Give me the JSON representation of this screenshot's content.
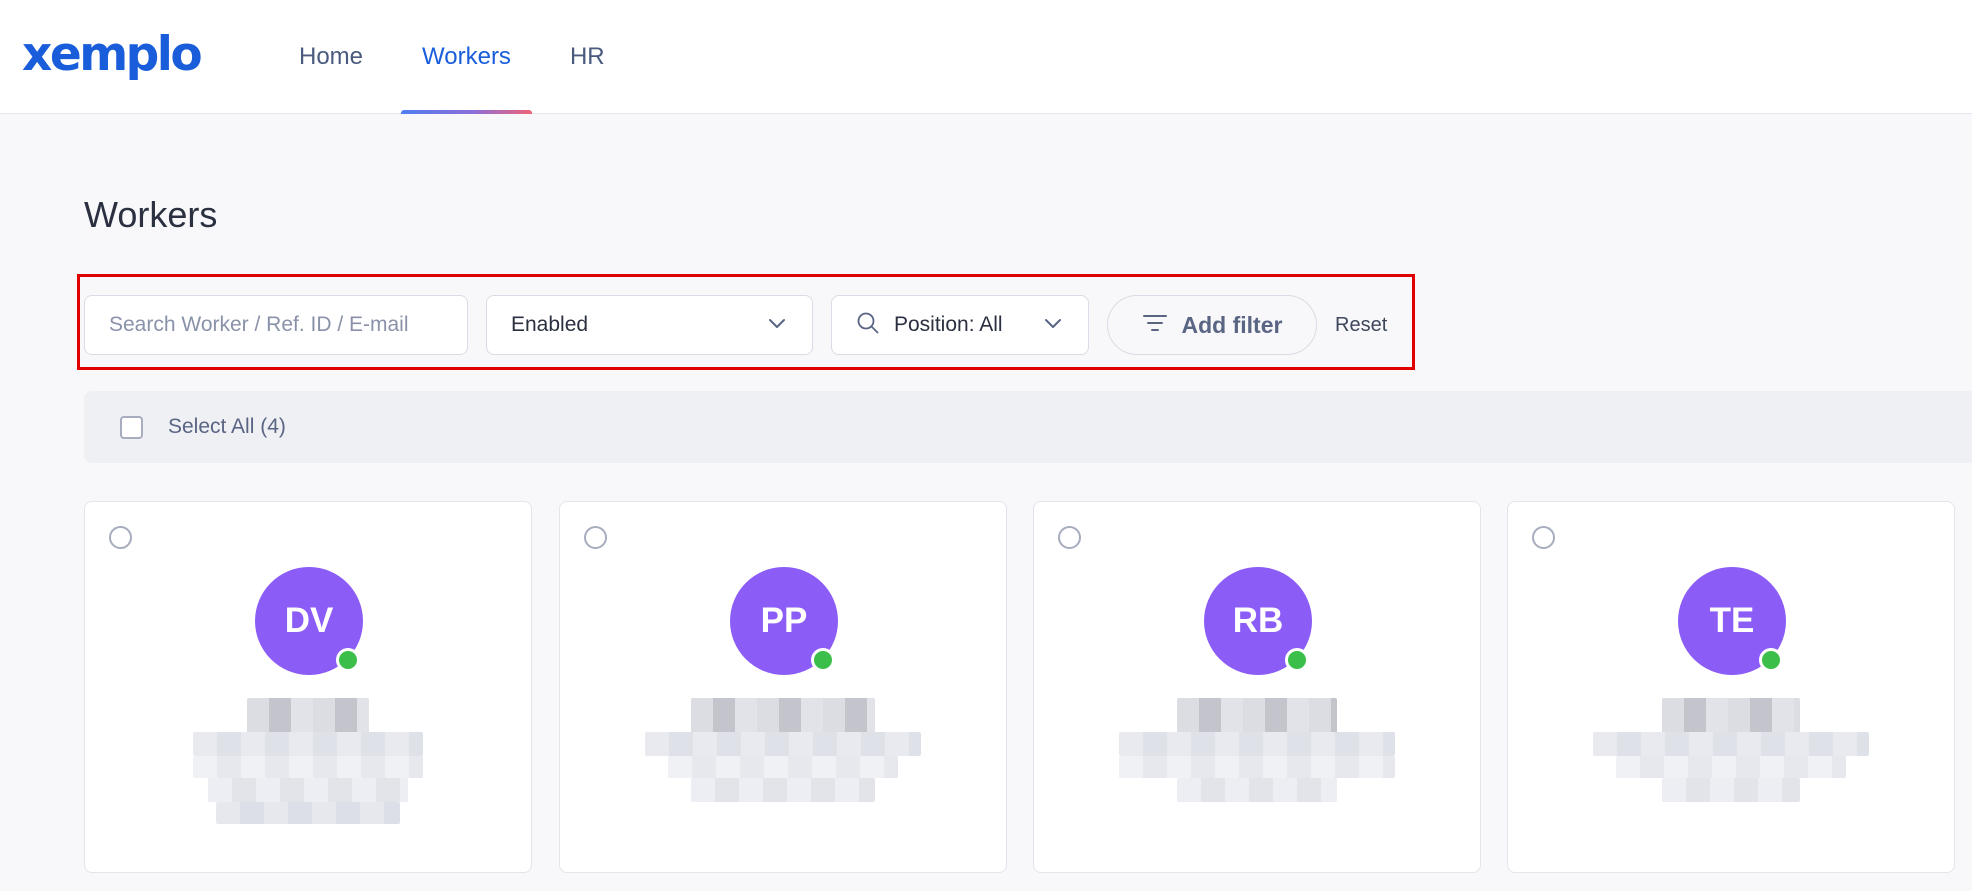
{
  "header": {
    "logo_text": "xemplo",
    "nav": [
      {
        "label": "Home",
        "active": false
      },
      {
        "label": "Workers",
        "active": true
      },
      {
        "label": "HR",
        "active": false
      }
    ]
  },
  "page": {
    "title": "Workers"
  },
  "filters": {
    "search_placeholder": "Search Worker / Ref. ID / E-mail",
    "status_value": "Enabled",
    "position_value": "Position: All",
    "add_filter_label": "Add filter",
    "reset_label": "Reset"
  },
  "selection": {
    "select_all_label": "Select All (4)"
  },
  "workers": [
    {
      "initials": "DV",
      "status": "online"
    },
    {
      "initials": "PP",
      "status": "online"
    },
    {
      "initials": "RB",
      "status": "online"
    },
    {
      "initials": "TE",
      "status": "online"
    }
  ],
  "colors": {
    "brand": "#1a5ddb",
    "avatar": "#8b5cf6",
    "online": "#3bbf4a",
    "highlight_outline": "#e00000"
  },
  "icons": {
    "status_dropdown": "chevron-down-icon",
    "position_search": "search-icon",
    "position_dropdown": "chevron-down-icon",
    "add_filter": "filter-lines-icon"
  }
}
